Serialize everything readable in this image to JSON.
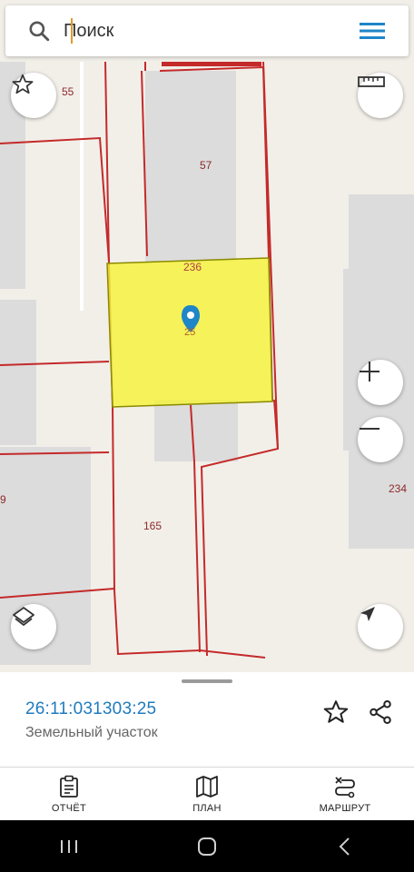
{
  "search": {
    "placeholder": "Поиск",
    "value": ""
  },
  "map": {
    "parcel_labels": {
      "p55": "55",
      "p57": "57",
      "p236": "236",
      "p25": "25",
      "p234": "234",
      "p165": "165",
      "p9": "9"
    },
    "highlight_color": "#f5f33a",
    "boundary_color": "#c42a2a",
    "marker_color": "#1f86c7"
  },
  "parcel": {
    "cadastral_number": "26:11:031303:25",
    "type": "Земельный участок"
  },
  "nav": {
    "report_label": "ОТЧЁТ",
    "plan_label": "ПЛАН",
    "route_label": "МАРШРУТ"
  },
  "icons": {
    "search": "search-icon",
    "menu": "hamburger-menu-icon",
    "favorite": "star-icon",
    "ruler": "ruler-icon",
    "zoom_in": "plus-icon",
    "zoom_out": "minus-icon",
    "layers": "layers-icon",
    "locate": "navigation-arrow-icon",
    "share": "share-icon"
  }
}
